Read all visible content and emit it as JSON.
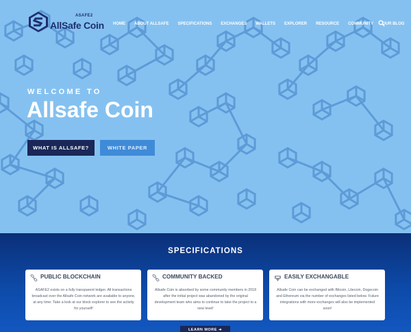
{
  "brand": {
    "top_label": "ASAFE2",
    "name": "AllSafe Coin"
  },
  "nav": {
    "items": [
      "HOME",
      "ABOUT ALLSAFE",
      "SPECIFICATIONS",
      "EXCHANGES",
      "WALLETS",
      "EXPLORER",
      "RESOURCE",
      "COMMUNITY",
      "OUR BLOG"
    ],
    "search_icon": "search-icon"
  },
  "hero": {
    "welcome": "WELCOME TO",
    "title": "Allsafe Coin",
    "primary_button": "WHAT IS ALLSAFE?",
    "secondary_button": "WHITE PAPER"
  },
  "specs": {
    "heading": "SPECIFICATIONS",
    "cards": [
      {
        "icon": "link-icon",
        "title": "PUBLIC BLOCKCHAIN",
        "text": "ASAFE2 exists on a fully transparent ledger. All transactions broadcast over the Allsafe Coin network are available to anyone, at any time. Take a look at our block explorer to see the activity for yourself!"
      },
      {
        "icon": "link-icon",
        "title": "COMMUNITY BACKED",
        "text": "Allsafe Coin is absorbed by some community members in 2018 after the initial project was abandoned by the original development team who aims to continue to take the project to a new level!"
      },
      {
        "icon": "exchange-icon",
        "title": "EASILY EXCHANGABLE",
        "text": "Allsafe Coin can be exchanged with Bitcoin, Litecoin, Dogecoin and Ethereum via the number of exchanges listed below. Future integrations with more exchanges will also be implemented soon!"
      }
    ],
    "learn_more": "LEARN MORE ➜"
  },
  "colors": {
    "hero_bg": "#85c1f0",
    "pattern": "#5d9bd8",
    "navy": "#1a2758",
    "button_blue": "#3f8bd8",
    "specs_bg": "#0d4aa8"
  }
}
